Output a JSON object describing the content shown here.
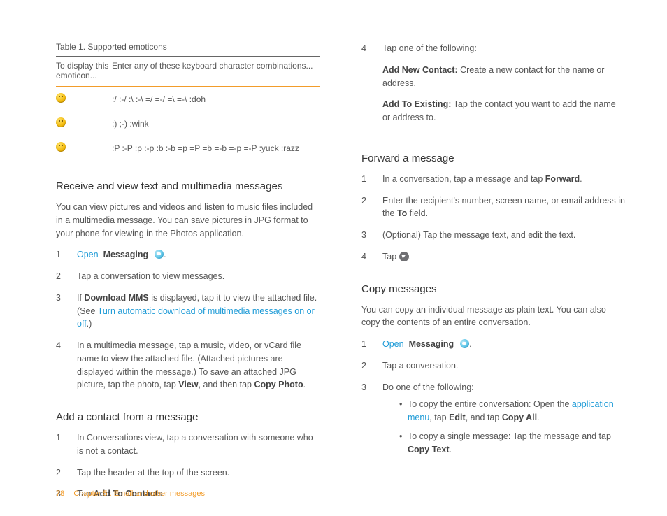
{
  "table": {
    "caption": "Table 1.  Supported emoticons",
    "head_col1": "To display this emoticon...",
    "head_col2": "Enter any of these keyboard character combinations...",
    "rows": [
      {
        "combos": ":/   :-/   :\\   :-\\   =/   =-/   =\\   =-\\   :doh"
      },
      {
        "combos": ";)   ;-)   :wink"
      },
      {
        "combos": ":P   :-P   :p   :-p   :b   :-b   =p   =P   =b   =-b   =-p   =-P   :yuck   :razz"
      }
    ]
  },
  "left": {
    "sec1": {
      "title": "Receive and view text and multimedia messages",
      "intro": "You can view pictures and videos and listen to music files included in a multimedia message. You can save pictures in JPG format to your phone for viewing in the Photos application.",
      "steps": {
        "s1_open": "Open",
        "s1_messaging": "Messaging",
        "s1_dot": ".",
        "s2": "Tap a conversation to view messages.",
        "s3_a": "If ",
        "s3_b": "Download MMS",
        "s3_c": " is displayed, tap it to view the attached file. (See ",
        "s3_link": "Turn automatic download of multimedia messages on or off",
        "s3_d": ".)",
        "s4_a": "In a multimedia message, tap a music, video, or vCard file name to view the attached file. (Attached pictures are displayed within the message.) To save an attached JPG picture, tap the photo, tap ",
        "s4_b": "View",
        "s4_c": ", and then tap ",
        "s4_d": "Copy Photo",
        "s4_e": "."
      }
    },
    "sec2": {
      "title": "Add a contact from a message",
      "steps": {
        "s1": "In Conversations view, tap a conversation with someone who is not a contact.",
        "s2": "Tap the header at the top of the screen.",
        "s3_a": "Tap ",
        "s3_b": "Add To Contacts",
        "s3_c": "."
      }
    }
  },
  "right": {
    "top": {
      "s4": "Tap one of the following:",
      "p1_b": "Add New Contact:",
      "p1_t": " Create a new contact for the name or address.",
      "p2_b": "Add To Existing:",
      "p2_t": " Tap the contact you want to add the name or address to."
    },
    "sec1": {
      "title": "Forward a message",
      "steps": {
        "s1_a": "In a conversation, tap a message and tap ",
        "s1_b": "Forward",
        "s1_c": ".",
        "s2_a": "Enter the recipient's number, screen name, or email address in the ",
        "s2_b": "To",
        "s2_c": " field.",
        "s3": "(Optional) Tap the message text, and edit the text.",
        "s4_a": "Tap ",
        "s4_b": "."
      }
    },
    "sec2": {
      "title": "Copy messages",
      "intro": "You can copy an individual message as plain text. You can also copy the contents of an entire conversation.",
      "steps": {
        "s1_open": "Open",
        "s1_messaging": "Messaging",
        "s1_dot": ".",
        "s2": "Tap a conversation.",
        "s3": "Do one of the following:",
        "b1_a": "To copy the entire conversation: Open the ",
        "b1_link": "application menu",
        "b1_b": ", tap ",
        "b1_c": "Edit",
        "b1_d": ", and tap ",
        "b1_e": "Copy All",
        "b1_f": ".",
        "b2_a": "To copy a single message: Tap the message and tap ",
        "b2_b": "Copy Text",
        "b2_c": "."
      }
    }
  },
  "footer": {
    "page": "78",
    "chapter": "Chapter 5 : Email and other messages"
  }
}
